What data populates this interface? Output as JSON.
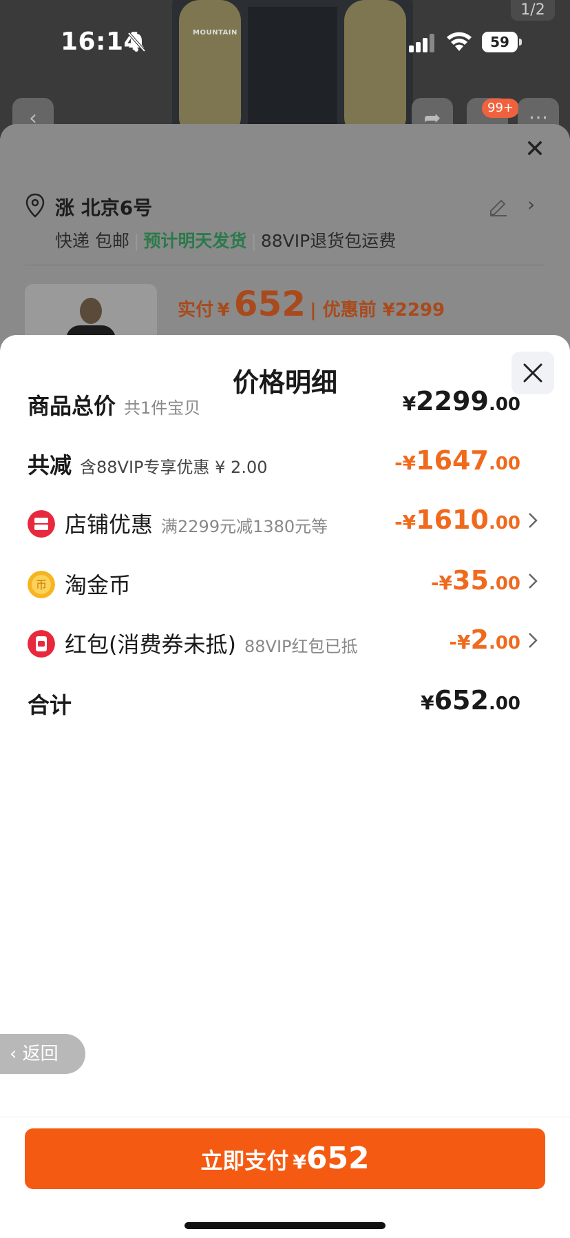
{
  "status": {
    "time": "16:14",
    "battery": "59",
    "page_counter": "1/2"
  },
  "product_image": {
    "logo_text": "MOUNTAIN"
  },
  "top_bar": {
    "cart_badge": "99+"
  },
  "order": {
    "address": "涨 北京6号",
    "shipping": "快递 包邮",
    "ship_estimate": "预计明天发货",
    "return_note": "88VIP退货包运费",
    "pay_label": "实付",
    "pay_currency": "¥",
    "pay_amount": "652",
    "pre_discount": "优惠前 ¥2299"
  },
  "price_detail": {
    "title": "价格明细",
    "rows": [
      {
        "label": "商品总价",
        "note": "共1件宝贝",
        "cur": "¥",
        "int": "2299",
        "dec": ".00"
      },
      {
        "label": "共减",
        "note": "含88VIP专享优惠 ¥ 2.00",
        "cur": "-¥",
        "int": "1647",
        "dec": ".00"
      },
      {
        "label": "店铺优惠",
        "note": "满2299元减1380元等",
        "cur": "-¥",
        "int": "1610",
        "dec": ".00"
      },
      {
        "label": "淘金币",
        "note": "",
        "cur": "-¥",
        "int": "35",
        "dec": ".00"
      },
      {
        "label": "红包(消费券未抵)",
        "note": "88VIP红包已抵",
        "cur": "-¥",
        "int": "2",
        "dec": ".00"
      },
      {
        "label": "合计",
        "note": "",
        "cur": "¥",
        "int": "652",
        "dec": ".00"
      }
    ]
  },
  "back_button": {
    "label": "返回"
  },
  "pay_button": {
    "label": "立即支付",
    "cur": "¥",
    "amount": "652"
  },
  "colors": {
    "accent": "#f55a12",
    "discount": "#f06a1e",
    "ship_green": "#2a7a4a"
  },
  "icons": [
    "bell-slash-icon",
    "signal-icon",
    "wifi-icon",
    "battery-icon",
    "back-chevron-icon",
    "share-icon",
    "cart-icon",
    "more-icon",
    "close-icon",
    "location-pin-icon",
    "edit-icon",
    "chevron-right-icon",
    "store-coupon-icon",
    "gold-coin-icon",
    "red-packet-icon"
  ]
}
